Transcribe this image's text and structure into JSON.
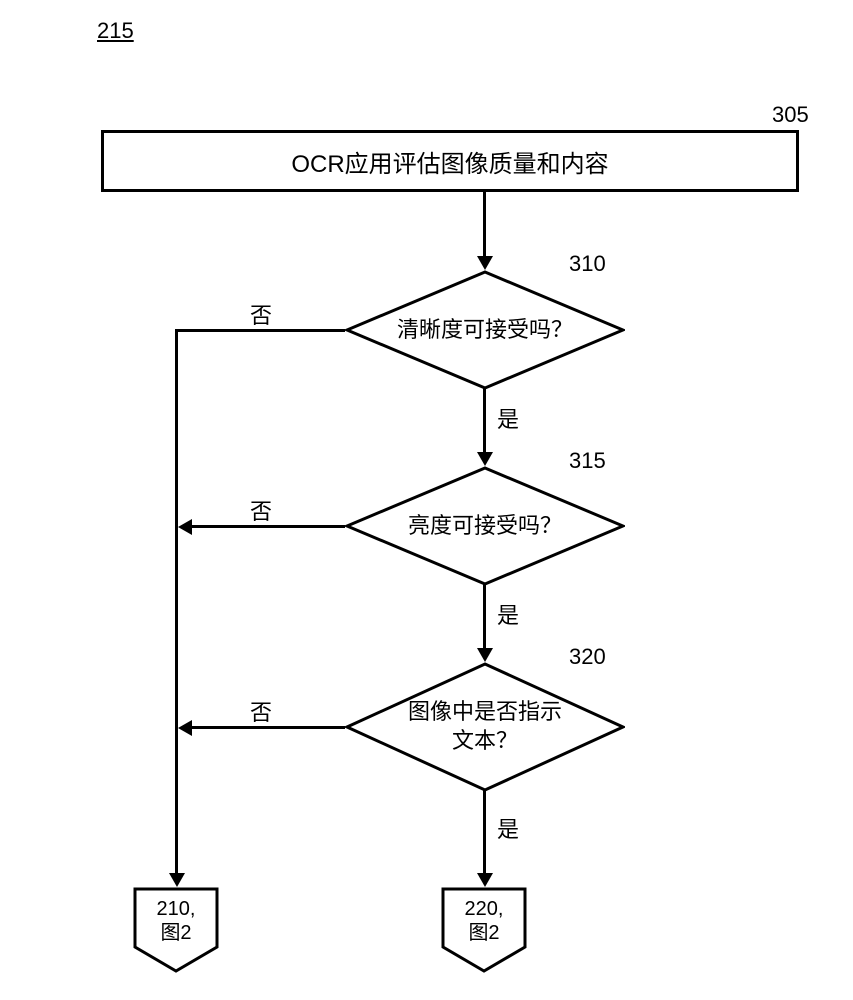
{
  "page_reference": "215",
  "nodes": {
    "n305": {
      "label": "305",
      "text": "OCR应用评估图像质量和内容"
    },
    "n310": {
      "label": "310",
      "text": "清晰度可接受吗？"
    },
    "n315": {
      "label": "315",
      "text": "亮度可接受吗？"
    },
    "n320": {
      "label": "320",
      "text_line1": "图像中是否指示",
      "text_line2": "文本？"
    },
    "c210": {
      "ref": "210,",
      "figure": "图2"
    },
    "c220": {
      "ref": "220,",
      "figure": "图2"
    }
  },
  "edges": {
    "yes": "是",
    "no": "否"
  }
}
